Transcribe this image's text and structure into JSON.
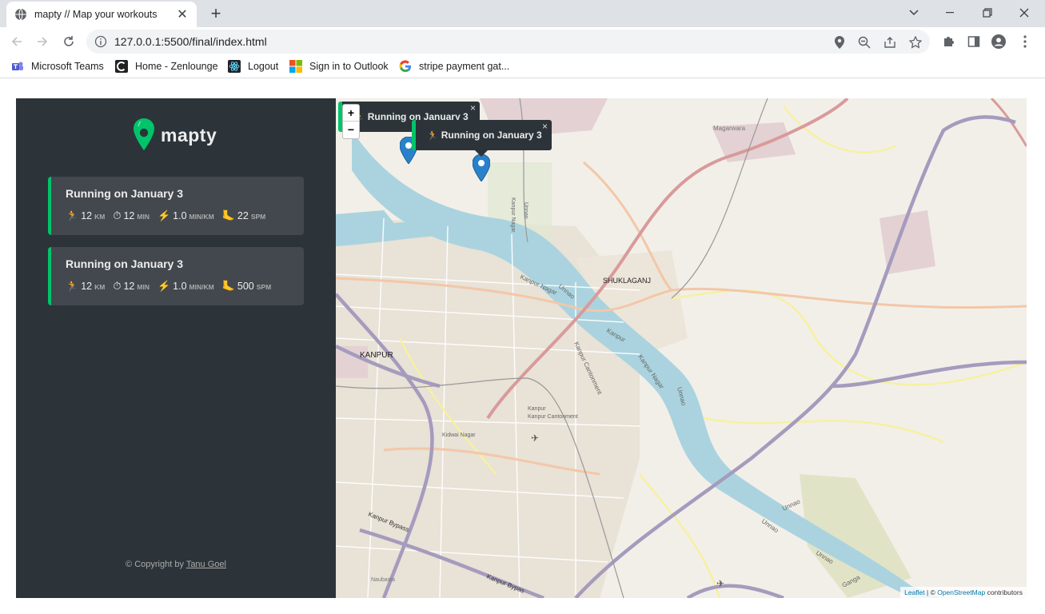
{
  "browser": {
    "tab_title": "mapty // Map your workouts",
    "url": "127.0.0.1:5500/final/index.html",
    "bookmarks": [
      {
        "label": "Microsoft Teams",
        "icon": "teams-icon"
      },
      {
        "label": "Home - Zenlounge",
        "icon": "zenlounge-icon"
      },
      {
        "label": "Logout",
        "icon": "react-icon"
      },
      {
        "label": "Sign in to Outlook",
        "icon": "microsoft-icon"
      },
      {
        "label": "stripe payment gat...",
        "icon": "google-icon"
      }
    ]
  },
  "app": {
    "logo_text": "mapty",
    "accent_color": "#00c46a",
    "sidebar_color": "#2d3439",
    "card_color": "#42484d"
  },
  "workouts": [
    {
      "title": "Running on January 3",
      "distance": {
        "icon": "🏃",
        "value": "12",
        "unit": "km"
      },
      "duration": {
        "icon": "⏱",
        "value": "12",
        "unit": "min"
      },
      "pace": {
        "icon": "⚡",
        "value": "1.0",
        "unit": "min/km"
      },
      "cadence": {
        "icon": "🦶",
        "value": "22",
        "unit": "spm"
      }
    },
    {
      "title": "Running on January 3",
      "distance": {
        "icon": "🏃",
        "value": "12",
        "unit": "km"
      },
      "duration": {
        "icon": "⏱",
        "value": "12",
        "unit": "min"
      },
      "pace": {
        "icon": "⚡",
        "value": "1.0",
        "unit": "min/km"
      },
      "cadence": {
        "icon": "🦶",
        "value": "500",
        "unit": "spm"
      }
    }
  ],
  "copyright": {
    "prefix": "© Copyright by ",
    "author": "Tanu Goel"
  },
  "map": {
    "zoom_in": "+",
    "zoom_out": "−",
    "popups": [
      {
        "label": "Running on January 3",
        "emoji": "🏃",
        "close": "×"
      },
      {
        "label": "Running on January 3",
        "emoji": "🏃",
        "close": "×"
      }
    ],
    "labels": {
      "kanpur": "KANPUR",
      "shuklaganj": "SHUKLAGANJ",
      "kanpur_nagar": "Kanpur Nagar",
      "kanpur_nagar_2": "Kanpur Nagar",
      "unnao": "Unnao",
      "unnao_2": "Unnao",
      "unnao_3": "Unnao",
      "unnao_4": "Unnao",
      "unnao_5": "Unnao",
      "unnao_6": "Unnao",
      "kanpur_river": "Kanpur",
      "kanpur_cantonment": "Kanpur Cantonment",
      "kanpur_cantonment_2": "Kanpur Cantonment",
      "kanpur_nagar_3": "Kanpur Nagar",
      "kidwai_nagar": "Kidwai Nagar",
      "kanpur_bypass": "Kanpur Bypass",
      "kanpur_bypass_2": "Kanpur Bypas",
      "naubasta": "Naubasta",
      "magarwara": "Magarwara",
      "kanpur_rail": "Kanpur",
      "ganga": "Ganga"
    },
    "attribution": {
      "leaflet": "Leaflet",
      "sep": " | © ",
      "osm": "OpenStreetMap",
      "suffix": " contributors"
    }
  }
}
